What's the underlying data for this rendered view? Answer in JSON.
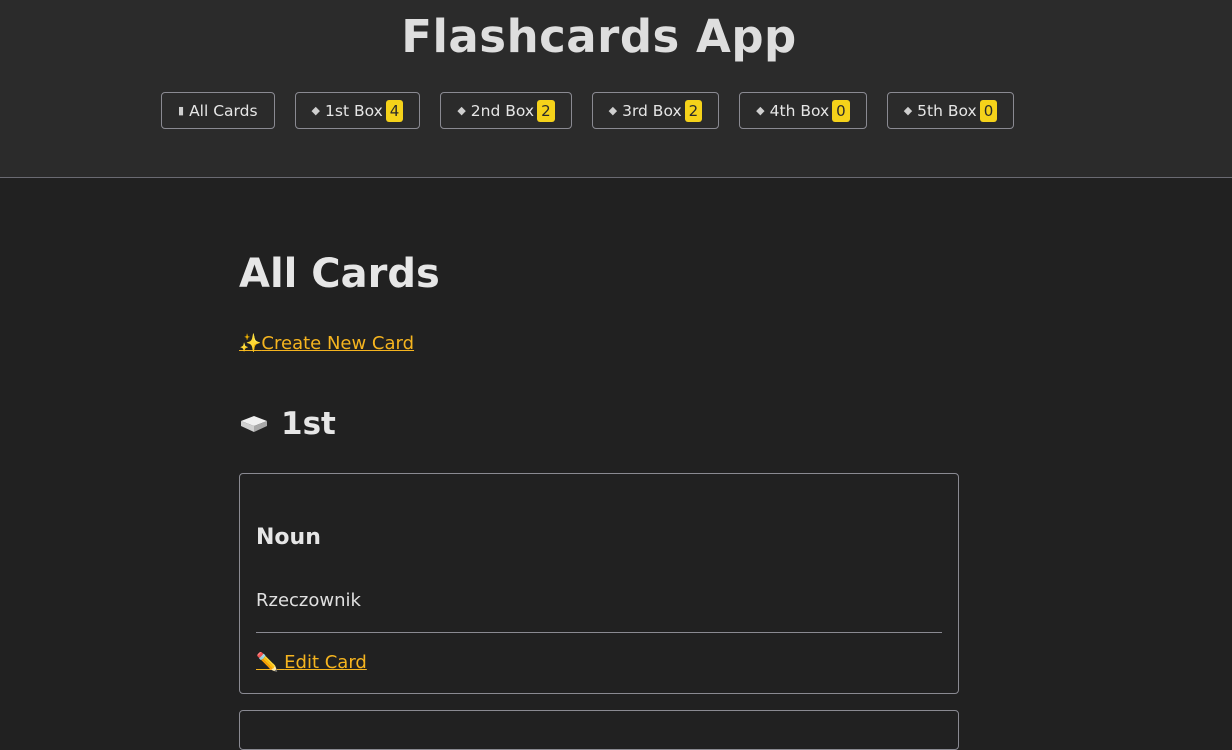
{
  "header": {
    "app_title": "Flashcards App"
  },
  "nav": {
    "items": [
      {
        "icon": "card-index-icon",
        "label": "All Cards",
        "count": null
      },
      {
        "icon": "inbox-tray-icon",
        "label": "1st Box",
        "count": "4"
      },
      {
        "icon": "inbox-tray-icon",
        "label": "2nd Box",
        "count": "2"
      },
      {
        "icon": "inbox-tray-icon",
        "label": "3rd Box",
        "count": "2"
      },
      {
        "icon": "inbox-tray-icon",
        "label": "4th Box",
        "count": "0"
      },
      {
        "icon": "inbox-tray-icon",
        "label": "5th Box",
        "count": "0"
      }
    ]
  },
  "main": {
    "page_title": "All Cards",
    "create_label": "Create New Card",
    "section_title": "1st",
    "card": {
      "front": "Noun",
      "back": "Rzeczownik",
      "edit_label": "Edit Card"
    }
  },
  "colors": {
    "accent": "#f5b41f",
    "badge": "#f5d21a",
    "background": "#212121",
    "header_background": "#2b2b2b"
  }
}
